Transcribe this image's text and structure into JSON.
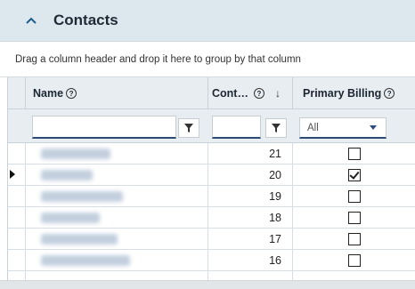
{
  "panel": {
    "title": "Contacts"
  },
  "group_hint": "Drag a column header and drop it here to group by that column",
  "columns": {
    "name": "Name",
    "count": "Cont…",
    "primary_billing": "Primary Billing"
  },
  "filters": {
    "name_value": "",
    "count_value": "",
    "primary_billing_selected": "All"
  },
  "rows": [
    {
      "name": "John Kenny",
      "count": "21",
      "primary_billing": false,
      "current": false
    },
    {
      "name": "Jeff Reis",
      "count": "20",
      "primary_billing": true,
      "current": true
    },
    {
      "name": "Amber Woods",
      "count": "19",
      "primary_billing": false,
      "current": false
    },
    {
      "name": "Amy Leiker",
      "count": "18",
      "primary_billing": false,
      "current": false
    },
    {
      "name": "Jessica Betts",
      "count": "17",
      "primary_billing": false,
      "current": false
    },
    {
      "name": "Emily Hartung",
      "count": "16",
      "primary_billing": false,
      "current": false
    }
  ],
  "colors": {
    "header_bg": "#dde8ee",
    "grid_header_bg": "#e7edf1",
    "accent_underline": "#2c4a73"
  },
  "icons": {
    "collapse": "chevron-up-icon",
    "help": "question-circle-icon",
    "sort": "arrow-down-icon",
    "filter": "funnel-icon",
    "dropdown": "caret-down-icon",
    "row_indicator": "triangle-right-icon"
  }
}
